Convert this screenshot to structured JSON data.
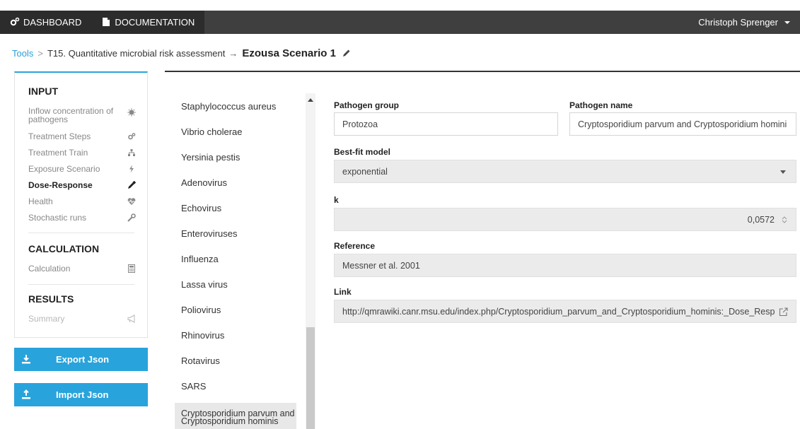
{
  "nav": {
    "dashboard_label": "DASHBOARD",
    "documentation_label": "DOCUMENTATION",
    "user_label": "Christoph Sprenger"
  },
  "breadcrumb": {
    "tools": "Tools",
    "separator": ">",
    "tool_name": "T15. Quantitative microbial risk assessment",
    "arrow": "→",
    "scenario": "Ezousa Scenario 1"
  },
  "sidebar": {
    "input_title": "INPUT",
    "input_items": [
      {
        "label": "Inflow concentration of pathogens",
        "icon": "virus-icon"
      },
      {
        "label": "Treatment Steps",
        "icon": "cogs-icon"
      },
      {
        "label": "Treatment Train",
        "icon": "sitemap-icon"
      },
      {
        "label": "Exposure Scenario",
        "icon": "bolt-icon"
      },
      {
        "label": "Dose-Response",
        "icon": "eyedropper-icon"
      },
      {
        "label": "Health",
        "icon": "heartbeat-icon"
      },
      {
        "label": "Stochastic runs",
        "icon": "wrench-icon"
      }
    ],
    "calculation_title": "CALCULATION",
    "calculation_item": "Calculation",
    "results_title": "RESULTS",
    "results_item": "Summary"
  },
  "buttons": {
    "export_label": "Export Json",
    "import_label": "Import Json"
  },
  "pathogens": [
    "Staphylococcus aureus",
    "Vibrio cholerae",
    "Yersinia pestis",
    "Adenovirus",
    "Echovirus",
    "Enteroviruses",
    "Influenza",
    "Lassa virus",
    "Poliovirus",
    "Rhinovirus",
    "Rotavirus",
    "SARS"
  ],
  "selected_pathogen": {
    "line1": "Cryptosporidium parvum and",
    "line2": "Cryptosporidium hominis"
  },
  "form": {
    "group_label": "Pathogen group",
    "group_value": "Protozoa",
    "name_label": "Pathogen name",
    "name_value": "Cryptosporidium parvum and Cryptosporidium homini",
    "model_label": "Best-fit model",
    "model_value": "exponential",
    "k_label": "k",
    "k_value": "0,0572",
    "reference_label": "Reference",
    "reference_value": "Messner et al. 2001",
    "link_label": "Link",
    "link_value": "http://qmrawiki.canr.msu.edu/index.php/Cryptosporidium_parvum_and_Cryptosporidium_hominis:_Dose_Resp"
  },
  "colors": {
    "accent": "#29a3dc",
    "topbar": "#3f3f3f"
  }
}
